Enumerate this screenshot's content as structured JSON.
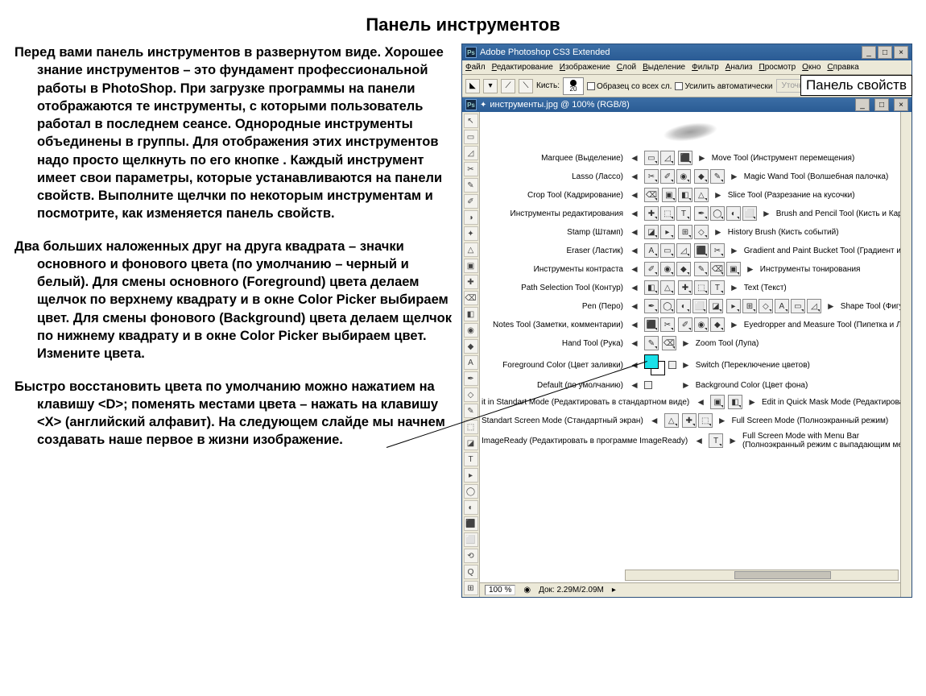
{
  "pageTitle": "Панель инструментов",
  "paragraphs": {
    "p1": "Перед вами панель инструментов  в развернутом виде.  Хорошее знание инструментов – это фундамент  профессиональной  работы в PhotoShop. При загрузке программы  на панели отображаются те инструменты,  с которыми пользователь  работал в последнем сеансе. Однородные инструменты  объединены  в группы. Для отображения этих инструментов  надо просто щелкнуть  по его кнопке .  Каждый инструмент  имеет свои параметры, которые устанавливаются  на панели свойств. Выполните  щелчки по некоторым инструментам  и посмотрите, как изменяется панель свойств.",
    "p2": "Два больших  наложенных  друг на друга квадрата – значки основного и фонового цвета (по умолчанию  – черный и белый). Для смены  основного (Foreground)  цвета делаем щелчок по верхнему квадрату и в окне Color Picker выбираем цвет. Для смены  фонового (Background)  цвета делаем щелчок по нижнему квадрату и в окне Color Picker выбираем цвет. Измените цвета.",
    "p3": "Быстро  восстановить  цвета по умолчанию можно  нажатием  на клавишу <D>; поменять местами цвета – нажать на клавишу <X> (английский  алфавит). На следующем слайде мы начнем создавать наше первое в жизни изображение."
  },
  "ps": {
    "title": "Adobe Photoshop CS3 Extended",
    "menus": [
      "Файл",
      "Редактирование",
      "Изображение",
      "Слой",
      "Выделение",
      "Фильтр",
      "Анализ",
      "Просмотр",
      "Окно",
      "Справка"
    ],
    "brushes_label": "Кисть:",
    "brush_size": "20",
    "opt1": "Образец со всех сл.",
    "opt2": "Усилить автоматически",
    "refine": "Уточнить край…",
    "propsTag": "Панель свойств",
    "docTitle": "инструменты.jpg @ 100% (RGB/8)",
    "zoom": "100 %",
    "docinfo": "Док: 2.29M/2.09M",
    "rows": [
      {
        "left": "Marquee (Выделение)",
        "ln": 2,
        "rn": 1,
        "right": "Move Tool (Инструмент перемещения)"
      },
      {
        "left": "Lasso (Лассо)",
        "ln": 3,
        "rn": 2,
        "right": "Magic Wand Tool (Волшебная палочка)"
      },
      {
        "left": "Crop Tool (Кадрирование)",
        "ln": 1,
        "rn": 3,
        "right": "Slice Tool (Разрезание на кусочки)"
      },
      {
        "left": "Инструменты редактирования",
        "ln": 3,
        "rn": 4,
        "right": "Brush and Pencil Tool (Кисть и Карандаш)"
      },
      {
        "left": "Stamp (Штамп)",
        "ln": 2,
        "rn": 2,
        "right": "History Brush (Кисть событий)"
      },
      {
        "left": "Eraser (Ластик)",
        "ln": 3,
        "rn": 2,
        "right": "Gradient and Paint Bucket Tool (Градиент и Заливка)"
      },
      {
        "left": "Инструменты контраста",
        "ln": 3,
        "rn": 3,
        "right": "Инструменты тонирования"
      },
      {
        "left": "Path Selection Tool (Контур)",
        "ln": 2,
        "rn": 3,
        "right": "Text (Текст)"
      },
      {
        "left": "Pen (Перо)",
        "ln": 5,
        "rn": 6,
        "right": "Shape Tool (Фигуры)"
      },
      {
        "left": "Notes Tool (Заметки, комментарии)",
        "ln": 2,
        "rn": 3,
        "right": "Eyedropper and Measure Tool (Пипетка и Линейка)"
      },
      {
        "left": "Hand Tool (Рука)",
        "ln": 1,
        "rn": 1,
        "right": "Zoom Tool (Лупа)"
      },
      {
        "left": "Foreground Color (Цвет заливки)",
        "swatch": true,
        "right": "Switch (Переключение цветов)"
      },
      {
        "left": "Default (по умолчанию)",
        "swatch2": true,
        "right": "Background Color (Цвет фона)"
      },
      {
        "left": "it in Standart Mode (Редактировать в стандартном виде)",
        "ln": 1,
        "rn": 1,
        "right": "Edit in Quick Mask Mode (Редактировать в режиме быстрой м"
      },
      {
        "left": "Standart Screen Mode (Стандартный экран)",
        "ln": 1,
        "rn": 2,
        "right": "Full Screen Mode (Полноэкранный режим)"
      },
      {
        "left": "ImageReady (Редактировать в программе ImageReady)",
        "ln": 1,
        "rn": 0,
        "right": "Full Screen Mode with Menu Bar",
        "right2": "(Полноэкранный режим с выпадающим меню)"
      }
    ]
  }
}
